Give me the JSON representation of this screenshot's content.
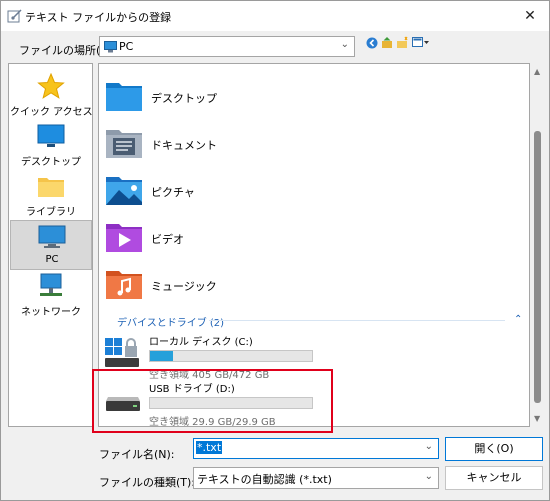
{
  "title": "テキスト ファイルからの登録",
  "location": {
    "label": "ファイルの場所(I):",
    "value": "PC"
  },
  "places": [
    {
      "label": "クイック アクセス",
      "icon": "star-icon"
    },
    {
      "label": "デスクトップ",
      "icon": "desktop-icon"
    },
    {
      "label": "ライブラリ",
      "icon": "library-folder-icon"
    },
    {
      "label": "PC",
      "icon": "pc-icon"
    },
    {
      "label": "ネットワーク",
      "icon": "network-icon"
    }
  ],
  "folders": [
    {
      "label": "デスクトップ",
      "icon": "desktop-folder-icon"
    },
    {
      "label": "ドキュメント",
      "icon": "documents-folder-icon"
    },
    {
      "label": "ピクチャ",
      "icon": "pictures-folder-icon"
    },
    {
      "label": "ビデオ",
      "icon": "videos-folder-icon"
    },
    {
      "label": "ミュージック",
      "icon": "music-folder-icon"
    }
  ],
  "group": {
    "label": "デバイスとドライブ (2)"
  },
  "drives": [
    {
      "name": "ローカル ディスク (C:)",
      "free": "空き領域 405 GB/472 GB",
      "used_fraction": 0.14,
      "icon": "windows-drive-icon"
    },
    {
      "name": "USB ドライブ (D:)",
      "free": "空き領域 29.9 GB/29.9 GB",
      "used_fraction": 0.0,
      "icon": "usb-drive-icon"
    }
  ],
  "filename": {
    "label": "ファイル名(N):",
    "value": "*.txt"
  },
  "filetype": {
    "label": "ファイルの種類(T):",
    "value": "テキストの自動認識 (*.txt)"
  },
  "buttons": {
    "open": "開く(O)",
    "cancel": "キャンセル"
  },
  "colors": {
    "accent": "#0078d7",
    "highlight": "#e0001b",
    "group": "#1a5fb4"
  }
}
